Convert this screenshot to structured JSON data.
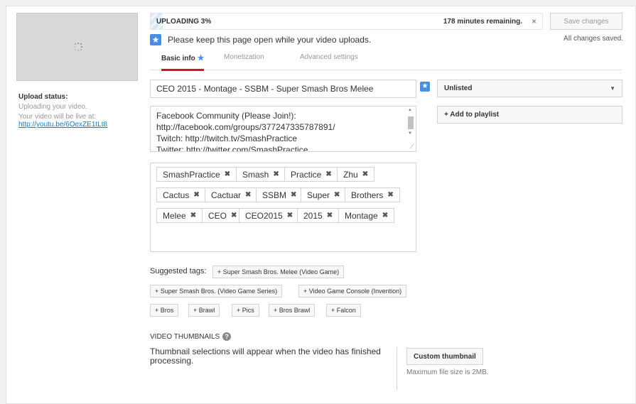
{
  "progress": {
    "label": "UPLOADING 3%",
    "percent": 3,
    "remaining": "178 minutes remaining.",
    "close_glyph": "×"
  },
  "notice": {
    "text": "Please keep this page open while your video uploads."
  },
  "save": {
    "button_label": "Save changes",
    "status": "All changes saved."
  },
  "upload_status": {
    "label": "Upload status:",
    "state": "Uploading your video.",
    "live_text": "Your video will be live at:",
    "url": "http://youtu.be/6OexZE1tLt8"
  },
  "tabs": [
    {
      "label": "Basic info",
      "active": true,
      "has_star": true
    },
    {
      "label": "Monetization",
      "active": false
    },
    {
      "label": "Advanced settings",
      "active": false
    }
  ],
  "title_field": {
    "value": "CEO 2015 - Montage - SSBM - Super Smash Bros Melee"
  },
  "privacy": {
    "selected": "Unlisted"
  },
  "playlist": {
    "label": "+ Add to playlist"
  },
  "description": {
    "lines": [
      "Facebook Community (Please Join!):",
      "http://facebook.com/groups/377247335787891/",
      "Twitch: http://twitch.tv/SmashPractice",
      "Twitter: http://twitter.com/SmashPractice"
    ]
  },
  "tags": [
    "SmashPractice",
    "Smash",
    "Practice",
    "Zhu",
    "Cactus",
    "Cactuar",
    "SSBM",
    "Super",
    "Brothers",
    "Melee",
    "CEO",
    "CEO2015",
    "2015",
    "Montage"
  ],
  "suggested": {
    "label": "Suggested tags:",
    "items": [
      "+ Super Smash Bros. Melee (Video Game)",
      "+ Super Smash Bros. (Video Game Series)",
      "+ Video Game Console (Invention)",
      "+ Bros",
      "+ Brawl",
      "+ Pics",
      "+ Bros Brawl",
      "+ Falcon"
    ]
  },
  "thumbnails": {
    "heading": "VIDEO THUMBNAILS",
    "message": "Thumbnail selections will appear when the video has finished processing.",
    "custom_button": "Custom thumbnail",
    "max_size": "Maximum file size is 2MB."
  },
  "colors": {
    "accent_red": "#cc181e",
    "star_blue": "#4a8ee2",
    "link_blue": "#167ac6"
  },
  "icons": {
    "star": "star-icon",
    "close": "close-icon",
    "tag_remove": "x-icon",
    "help": "help-icon",
    "dropdown": "chevron-down-icon"
  }
}
